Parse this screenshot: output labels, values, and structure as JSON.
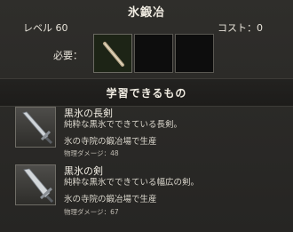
{
  "window": {
    "title": "氷鍛冶"
  },
  "header": {
    "level": "レベル 60",
    "cost": "コスト：0"
  },
  "requirements": {
    "label": "必要："
  },
  "learnable": {
    "title": "学習できるもの",
    "items": [
      {
        "name": "黒氷の長剣",
        "description": "純粋な黒氷でできている長剣。",
        "location": "氷の寺院の鍛冶場で生産",
        "stat": "物理ダメージ：48"
      },
      {
        "name": "黒氷の剣",
        "description": "純粋な黒氷でできている幅広の剣。",
        "location": "氷の寺院の鍛冶場で生産",
        "stat": "物理ダメージ：67"
      }
    ]
  },
  "colors": {
    "background": "#2a2926",
    "text": "#e8e4da",
    "slot": "#0d0d0d"
  }
}
